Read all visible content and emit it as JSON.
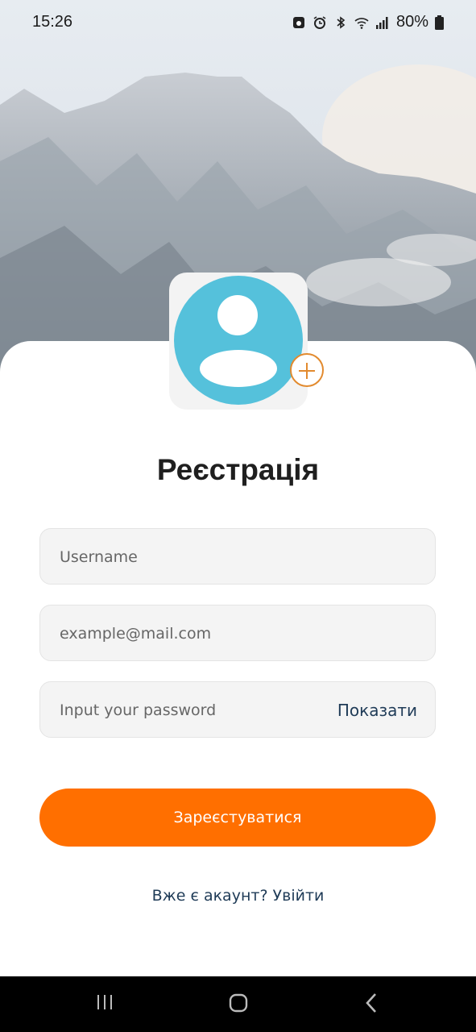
{
  "status_bar": {
    "time": "15:26",
    "battery": "80%",
    "icons": [
      "screenshot-icon",
      "alarm-icon",
      "bluetooth-icon",
      "wifi-icon",
      "signal-icon",
      "battery-icon"
    ]
  },
  "avatar": {
    "icon": "avatar-placeholder-icon",
    "add_icon": "plus-circle-icon",
    "colors": {
      "circle": "#55c1db",
      "plus": "#e28a2e"
    }
  },
  "form": {
    "title": "Реєстрація",
    "username": {
      "placeholder": "Username",
      "value": ""
    },
    "email": {
      "placeholder": "example@mail.com",
      "value": ""
    },
    "password": {
      "placeholder": "Input your password",
      "value": "",
      "toggle_label": "Показати"
    },
    "submit_label": "Зареєстуватися",
    "login_link": "Вже є акаунт? Увійти",
    "colors": {
      "accent": "#ff6f00",
      "link": "#1f3b57"
    }
  },
  "nav_bar": {
    "icons": [
      "recent-apps-icon",
      "home-icon",
      "back-icon"
    ]
  }
}
